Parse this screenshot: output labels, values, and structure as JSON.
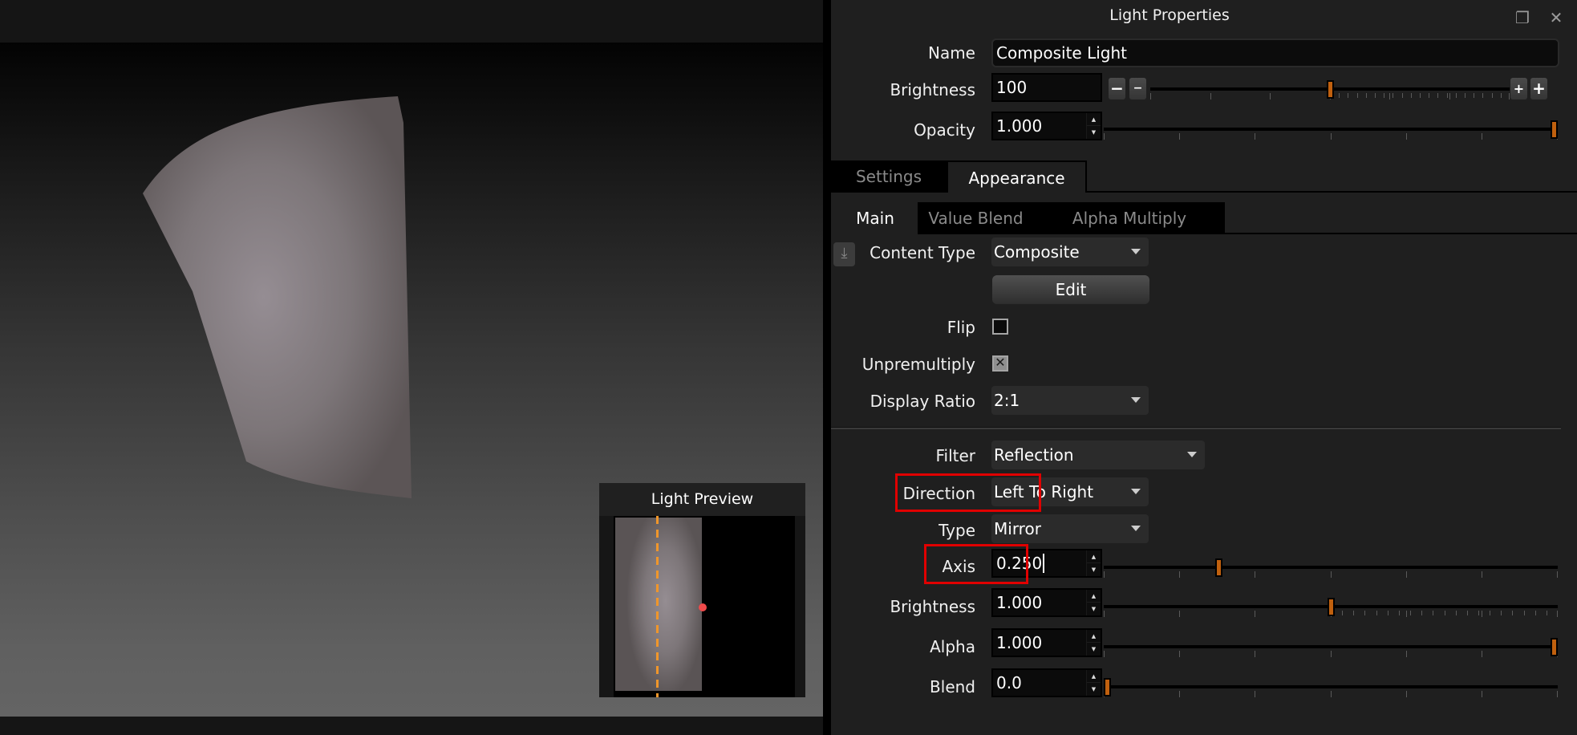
{
  "viewport": {
    "preview": {
      "title": "Light Preview"
    }
  },
  "panel": {
    "title": "Light Properties",
    "icons": {
      "float": "float-window-icon",
      "close": "close-icon"
    },
    "name": {
      "label": "Name",
      "value": "Composite Light"
    },
    "brightness": {
      "label": "Brightness",
      "value": "100",
      "dec_large": "−",
      "dec_small": "−",
      "inc_small": "+",
      "inc_large": "+",
      "slider_fraction": 0.5
    },
    "opacity": {
      "label": "Opacity",
      "value": "1.000",
      "slider_fraction": 1.0
    },
    "tabs": [
      {
        "label": "Settings",
        "active": false
      },
      {
        "label": "Appearance",
        "active": true
      }
    ],
    "subtabs": [
      {
        "label": "Main",
        "active": true
      },
      {
        "label": "Value Blend",
        "active": false
      },
      {
        "label": "Alpha Multiply",
        "active": false
      }
    ],
    "content_type": {
      "label": "Content Type",
      "value": "Composite"
    },
    "edit_label": "Edit",
    "flip": {
      "label": "Flip",
      "checked": false
    },
    "unpremultiply": {
      "label": "Unpremultiply",
      "checked": true
    },
    "display_ratio": {
      "label": "Display Ratio",
      "value": "2:1"
    },
    "filter": {
      "label": "Filter",
      "value": "Reflection"
    },
    "direction": {
      "label": "Direction",
      "value": "Left To Right"
    },
    "type": {
      "label": "Type",
      "value": "Mirror"
    },
    "axis": {
      "label": "Axis",
      "value": "0.250",
      "slider_fraction": 0.25
    },
    "filter_brightness": {
      "label": "Brightness",
      "value": "1.000",
      "slider_fraction": 0.5
    },
    "alpha": {
      "label": "Alpha",
      "value": "1.000",
      "slider_fraction": 1.0
    },
    "blend": {
      "label": "Blend",
      "value": "0.0",
      "slider_fraction": 0.0
    }
  },
  "colors": {
    "accent_handle": "#c0600e",
    "highlight": "#e00000",
    "preview_axis": "#f0962a",
    "preview_dot": "#f04a4a"
  }
}
